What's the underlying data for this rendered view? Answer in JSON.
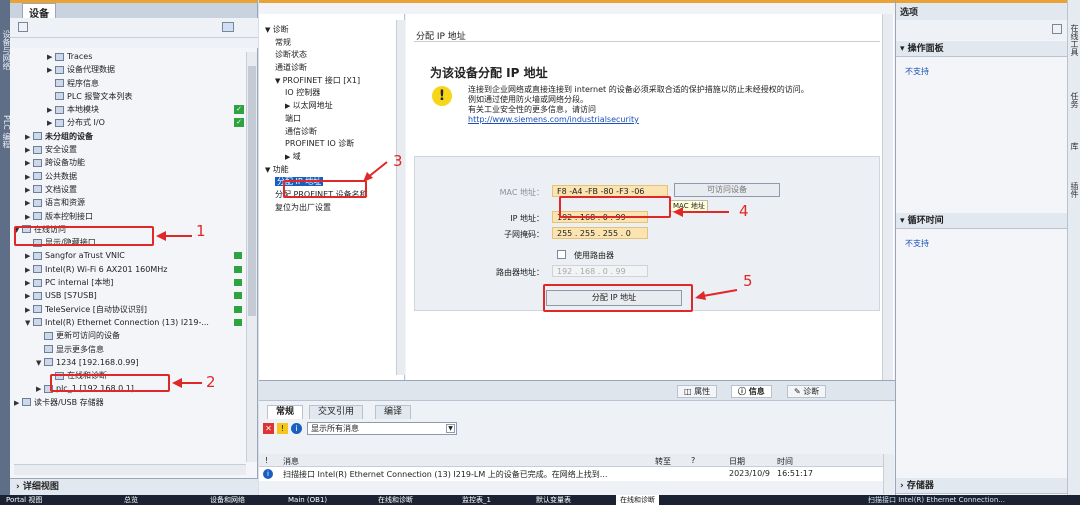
{
  "left_panel": {
    "title": "设备",
    "items": [
      {
        "label": "Traces",
        "indent": 3,
        "arrow": "▶"
      },
      {
        "label": "设备代理数据",
        "indent": 3,
        "arrow": "▶"
      },
      {
        "label": "程序信息",
        "indent": 3,
        "arrow": ""
      },
      {
        "label": "PLC 报警文本列表",
        "indent": 3,
        "arrow": ""
      },
      {
        "label": "本地模块",
        "indent": 3,
        "arrow": "▶",
        "check": true
      },
      {
        "label": "分布式 I/O",
        "indent": 3,
        "arrow": "▶",
        "check": true
      },
      {
        "label": "未分组的设备",
        "indent": 1,
        "arrow": "▶",
        "bold": true
      },
      {
        "label": "安全设置",
        "indent": 1,
        "arrow": "▶"
      },
      {
        "label": "跨设备功能",
        "indent": 1,
        "arrow": "▶"
      },
      {
        "label": "公共数据",
        "indent": 1,
        "arrow": "▶"
      },
      {
        "label": "文档设置",
        "indent": 1,
        "arrow": "▶"
      },
      {
        "label": "语言和资源",
        "indent": 1,
        "arrow": "▶"
      },
      {
        "label": "版本控制接口",
        "indent": 1,
        "arrow": "▶"
      },
      {
        "label": "在线访问",
        "indent": 0,
        "arrow": "▼"
      },
      {
        "label": "显示/隐藏接口",
        "indent": 1,
        "arrow": ""
      },
      {
        "label": "Sangfor aTrust VNIC",
        "indent": 1,
        "arrow": "▶",
        "stack": true
      },
      {
        "label": "Intel(R) Wi-Fi 6 AX201 160MHz",
        "indent": 1,
        "arrow": "▶",
        "stack": true
      },
      {
        "label": "PC internal [本地]",
        "indent": 1,
        "arrow": "▶",
        "stack": true
      },
      {
        "label": "USB [S7USB]",
        "indent": 1,
        "arrow": "▶",
        "stack": true
      },
      {
        "label": "TeleService [自动协议识别]",
        "indent": 1,
        "arrow": "▶",
        "stack": true
      },
      {
        "label": "Intel(R) Ethernet Connection (13) I219-...",
        "indent": 1,
        "arrow": "▼",
        "stack": true
      },
      {
        "label": "更新可访问的设备",
        "indent": 2,
        "arrow": ""
      },
      {
        "label": "显示更多信息",
        "indent": 2,
        "arrow": ""
      },
      {
        "label": "1234 [192.168.0.99]",
        "indent": 2,
        "arrow": "▼"
      },
      {
        "label": "在线和诊断",
        "indent": 3,
        "arrow": ""
      },
      {
        "label": "plc_1 [192.168.0.1]",
        "indent": 2,
        "arrow": "▶"
      },
      {
        "label": "读卡器/USB 存储器",
        "indent": 0,
        "arrow": "▶"
      }
    ],
    "details": "详细视图"
  },
  "vertical_tabs": {
    "left": [
      "设备与网络",
      "PLC 编程"
    ],
    "right": [
      "在线工具",
      "任务",
      "库",
      "插件"
    ]
  },
  "nav": {
    "items": [
      {
        "label": "诊断",
        "indent": 0,
        "arrow": "▼"
      },
      {
        "label": "常规",
        "indent": 1
      },
      {
        "label": "诊断状态",
        "indent": 1
      },
      {
        "label": "通道诊断",
        "indent": 1
      },
      {
        "label": "PROFINET 接口 [X1]",
        "indent": 1,
        "arrow": "▼"
      },
      {
        "label": "IO 控制器",
        "indent": 2
      },
      {
        "label": "以太网地址",
        "indent": 2,
        "arrow": "▶"
      },
      {
        "label": "端口",
        "indent": 2
      },
      {
        "label": "通信诊断",
        "indent": 2
      },
      {
        "label": "PROFINET IO 诊断",
        "indent": 2
      },
      {
        "label": "域",
        "indent": 2,
        "arrow": "▶"
      },
      {
        "label": "功能",
        "indent": 0,
        "arrow": "▼"
      },
      {
        "label": "分配 IP 地址",
        "indent": 1,
        "selected": true
      },
      {
        "label": "分配 PROFINET 设备名称",
        "indent": 1
      },
      {
        "label": "复位为出厂设置",
        "indent": 1
      }
    ]
  },
  "content": {
    "header": "分配 IP 地址",
    "heading": "为该设备分配 IP 地址",
    "warning_line1": "连接到企业网络或直接连接到 internet 的设备必须采取合适的保护措施以防止未经授权的访问。",
    "warning_line2": "例如通过使用防火墙或网络分段。",
    "warning_line3": "有关工业安全性的更多信息，请访问",
    "link": "http://www.siemens.com/industrialsecurity",
    "mac_label": "MAC 地址：",
    "mac_value": "F8 -A4 -FB -80 -F3 -06",
    "accessible_devices_button": "可访问设备",
    "mac_tooltip": "MAC 地址",
    "ip_label": "IP 地址：",
    "ip_value": "192 . 168 . 0   . 99",
    "subnet_label": "子网掩码：",
    "subnet_value": "255 . 255 . 255 . 0",
    "use_router_label": "使用路由器",
    "router_label": "路由器地址：",
    "router_value": "192 . 168 . 0   . 99",
    "assign_button": "分配 IP 地址"
  },
  "info": {
    "top_tabs": [
      "属性",
      "信息",
      "诊断"
    ],
    "tabs": [
      "常规",
      "交叉引用",
      "编译"
    ],
    "filter": "显示所有消息",
    "columns": [
      "!",
      "消息",
      "转至",
      "?",
      "日期",
      "时间"
    ],
    "row": {
      "message": "扫描接口 Intel(R) Ethernet Connection (13) I219-LM 上的设备已完成。在网络上找到...",
      "date": "2023/10/9",
      "time": "16:51:17"
    }
  },
  "right_panel": {
    "title": "选项",
    "sections": [
      {
        "label": "操作面板",
        "status": "不支持"
      },
      {
        "label": "循环时间",
        "status": "不支持"
      },
      {
        "label": "存储器",
        "status": ""
      }
    ]
  },
  "annotations": [
    "1",
    "2",
    "3",
    "4",
    "5"
  ],
  "taskbar": {
    "items": [
      "Portal 视图",
      "总览",
      "设备和网络",
      "Main (OB1)",
      "在线和诊断",
      "监控表_1",
      "默认变量表",
      "在线和诊断"
    ],
    "status": "扫描接口 Intel(R) Ethernet Connection..."
  }
}
